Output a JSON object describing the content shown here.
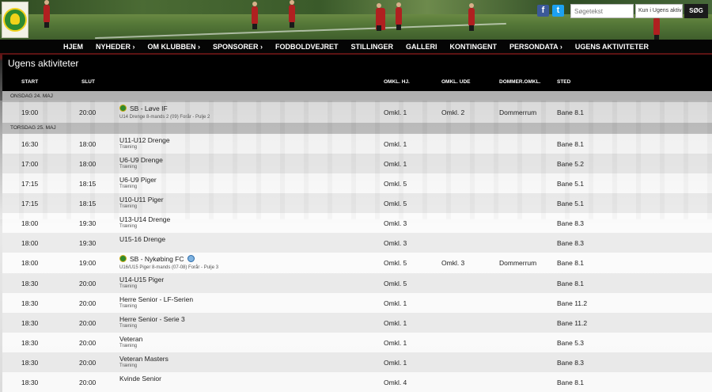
{
  "header": {
    "search_placeholder": "Søgetekst",
    "search_scope": "Kun i Ugens aktiv",
    "search_button": "SØG",
    "facebook": "f",
    "twitter": "t"
  },
  "nav": [
    "HJEM",
    "NYHEDER ›",
    "OM KLUBBEN ›",
    "SPONSORER ›",
    "FODBOLDVEJRET",
    "STILLINGER",
    "GALLERI",
    "KONTINGENT",
    "PERSONDATA ›",
    "UGENS AKTIVITETER"
  ],
  "panel": {
    "title": "Ugens aktiviteter",
    "columns": {
      "start": "START",
      "slut": "SLUT",
      "hj": "OMKL. HJ.",
      "ude": "OMKL. UDE",
      "dommer": "DOMMER.OMKL.",
      "sted": "STED"
    }
  },
  "days": [
    {
      "label": "ONSDAG 24. MAJ",
      "rows": [
        {
          "start": "19:00",
          "end": "20:00",
          "title": "SB - Løve IF",
          "sub": "U14 Drenge 8-mands 2 (09) Forår - Pulje 2",
          "hj": "Omkl. 1",
          "ude": "Omkl. 2",
          "dommer": "Dommerrum",
          "sted": "Bane 8.1",
          "match": true
        }
      ]
    },
    {
      "label": "TORSDAG 25. MAJ",
      "rows": [
        {
          "start": "16:30",
          "end": "18:00",
          "title": "U11-U12 Drenge",
          "sub": "Træning",
          "hj": "Omkl. 1",
          "ude": "",
          "dommer": "",
          "sted": "Bane 8.1"
        },
        {
          "start": "17:00",
          "end": "18:00",
          "title": "U6-U9 Drenge",
          "sub": "Træning",
          "hj": "Omkl. 1",
          "ude": "",
          "dommer": "",
          "sted": "Bane 5.2"
        },
        {
          "start": "17:15",
          "end": "18:15",
          "title": "U6-U9 Piger",
          "sub": "Træning",
          "hj": "Omkl. 5",
          "ude": "",
          "dommer": "",
          "sted": "Bane 5.1"
        },
        {
          "start": "17:15",
          "end": "18:15",
          "title": "U10-U11 Piger",
          "sub": "Træning",
          "hj": "Omkl. 5",
          "ude": "",
          "dommer": "",
          "sted": "Bane 5.1"
        },
        {
          "start": "18:00",
          "end": "19:30",
          "title": "U13-U14 Drenge",
          "sub": "Træning",
          "hj": "Omkl. 3",
          "ude": "",
          "dommer": "",
          "sted": "Bane 8.3"
        },
        {
          "start": "18:00",
          "end": "19:30",
          "title": "U15-16 Drenge",
          "sub": "",
          "hj": "Omkl. 3",
          "ude": "",
          "dommer": "",
          "sted": "Bane 8.3"
        },
        {
          "start": "18:00",
          "end": "19:00",
          "title": "SB - Nykøbing FC",
          "sub": "U16/U15 Piger 8-mands (07-08) Forår - Pulje 3",
          "hj": "Omkl. 5",
          "ude": "Omkl. 3",
          "dommer": "Dommerrum",
          "sted": "Bane 8.1",
          "match": true,
          "away_badge": true
        },
        {
          "start": "18:30",
          "end": "20:00",
          "title": "U14-U15 Piger",
          "sub": "Træning",
          "hj": "Omkl. 5",
          "ude": "",
          "dommer": "",
          "sted": "Bane 8.1"
        },
        {
          "start": "18:30",
          "end": "20:00",
          "title": "Herre Senior - LF-Serien",
          "sub": "Træning",
          "hj": "Omkl. 1",
          "ude": "",
          "dommer": "",
          "sted": "Bane 11.2"
        },
        {
          "start": "18:30",
          "end": "20:00",
          "title": "Herre Senior - Serie 3",
          "sub": "Træning",
          "hj": "Omkl. 1",
          "ude": "",
          "dommer": "",
          "sted": "Bane 11.2"
        },
        {
          "start": "18:30",
          "end": "20:00",
          "title": "Veteran",
          "sub": "Træning",
          "hj": "Omkl. 1",
          "ude": "",
          "dommer": "",
          "sted": "Bane 5.3"
        },
        {
          "start": "18:30",
          "end": "20:00",
          "title": "Veteran Masters",
          "sub": "Træning",
          "hj": "Omkl. 1",
          "ude": "",
          "dommer": "",
          "sted": "Bane 8.3"
        },
        {
          "start": "18:30",
          "end": "20:00",
          "title": "Kvinde Senior",
          "sub": "",
          "hj": "Omkl. 4",
          "ude": "",
          "dommer": "",
          "sted": "Bane 8.1"
        }
      ]
    }
  ]
}
